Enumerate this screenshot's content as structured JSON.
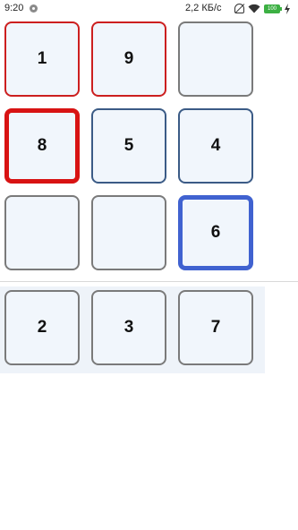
{
  "status_bar": {
    "time": "9:20",
    "network_speed": "2,2 КБ/с",
    "battery_level": "100",
    "icons": [
      "app-notification-icon",
      "silent-icon",
      "wifi-icon",
      "battery-icon",
      "charging-bolt-icon"
    ]
  },
  "board": {
    "cells": [
      {
        "value": "1",
        "state": "red"
      },
      {
        "value": "9",
        "state": "red"
      },
      {
        "value": "",
        "state": "empty"
      },
      {
        "value": "8",
        "state": "red-selected"
      },
      {
        "value": "5",
        "state": "blue"
      },
      {
        "value": "4",
        "state": "blue"
      },
      {
        "value": "",
        "state": "empty"
      },
      {
        "value": "",
        "state": "empty"
      },
      {
        "value": "6",
        "state": "blue-selected"
      }
    ]
  },
  "tray": {
    "tiles": [
      "2",
      "3",
      "7"
    ]
  },
  "colors": {
    "red_border": "#cc1f1f",
    "red_selected_border": "#d81313",
    "blue_border": "#3b5b86",
    "blue_selected_border": "#4062d0",
    "tile_background": "#f1f6fc",
    "tray_background": "#eef3f9"
  }
}
